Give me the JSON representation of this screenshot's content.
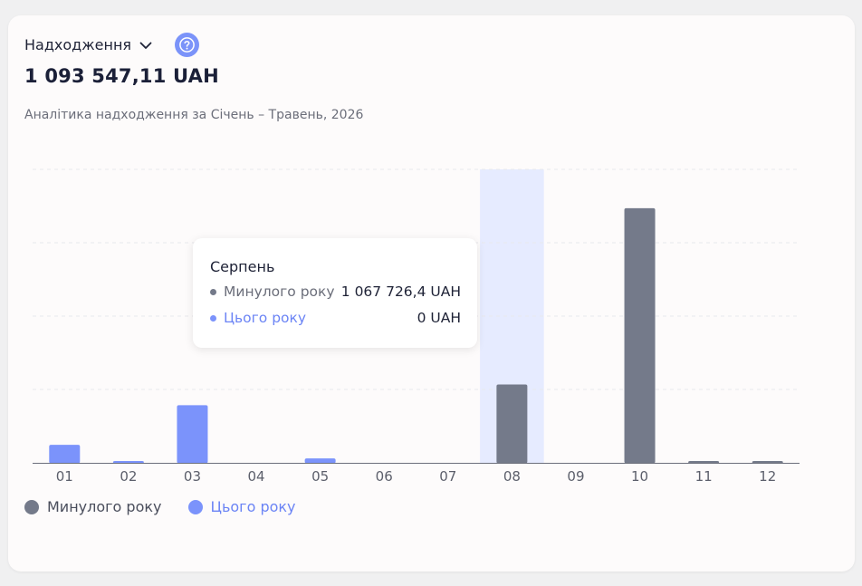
{
  "header": {
    "metric": "Надходження",
    "total": "1 093 547,11 UAH",
    "subtitle": "Аналітика надходження за Січень – Травень, 2026"
  },
  "colors": {
    "last_year": "#747a8a",
    "this_year": "#7b93fb",
    "highlight": "#e6ebff",
    "grid": "#e8e8ec"
  },
  "tooltip": {
    "title": "Серпень",
    "rows": [
      {
        "label": "Минулого року",
        "value": "1 067 726,4 UAH"
      },
      {
        "label": "Цього року",
        "value": "0 UAH"
      }
    ]
  },
  "legend": {
    "last_year": "Минулого року",
    "this_year": "Цього року"
  },
  "chart_data": {
    "type": "bar",
    "categories": [
      "01",
      "02",
      "03",
      "04",
      "05",
      "06",
      "07",
      "08",
      "09",
      "10",
      "11",
      "12"
    ],
    "series": [
      {
        "name": "Минулого року",
        "values": [
          0,
          0,
          0,
          0,
          0,
          0,
          0,
          1067726.4,
          0,
          3470000,
          8000,
          12000
        ]
      },
      {
        "name": "Цього року",
        "values": [
          245000,
          12000,
          785000,
          0,
          60000,
          0,
          0,
          0,
          0,
          0,
          0,
          0
        ]
      }
    ],
    "ylim": [
      0,
      4000000
    ],
    "highlighted_category": "08",
    "grid": true,
    "legend_position": "bottom-left"
  }
}
